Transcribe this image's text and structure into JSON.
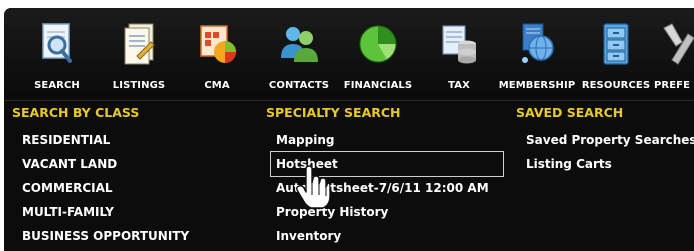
{
  "toolbar": {
    "items": [
      {
        "label": "SEARCH",
        "icon": "search-document-icon"
      },
      {
        "label": "LISTINGS",
        "icon": "listings-document-icon"
      },
      {
        "label": "CMA",
        "icon": "cma-chart-icon"
      },
      {
        "label": "CONTACTS",
        "icon": "contacts-people-icon"
      },
      {
        "label": "FINANCIALS",
        "icon": "financials-pie-icon"
      },
      {
        "label": "TAX",
        "icon": "tax-database-icon"
      },
      {
        "label": "MEMBERSHIP",
        "icon": "membership-network-icon"
      },
      {
        "label": "RESOURCES",
        "icon": "resources-cabinet-icon"
      },
      {
        "label": "PREFE",
        "icon": "preferences-tools-icon"
      }
    ]
  },
  "search_by_class": {
    "heading": "SEARCH BY CLASS",
    "items": [
      "RESIDENTIAL",
      "VACANT LAND",
      "COMMERCIAL",
      "MULTI-FAMILY",
      "BUSINESS OPPORTUNITY"
    ]
  },
  "specialty_search": {
    "heading": "SPECIALTY SEARCH",
    "items": [
      "Mapping",
      "Hotsheet",
      "Auto Hotsheet-7/6/11 12:00 AM",
      "Property History",
      "Inventory"
    ]
  },
  "saved_search": {
    "heading": "SAVED SEARCH",
    "items": [
      "Saved Property Searches",
      "Listing Carts"
    ]
  },
  "colors": {
    "background": "#0c0c0c",
    "heading": "#e8c92a",
    "item_text": "#ffffff"
  }
}
